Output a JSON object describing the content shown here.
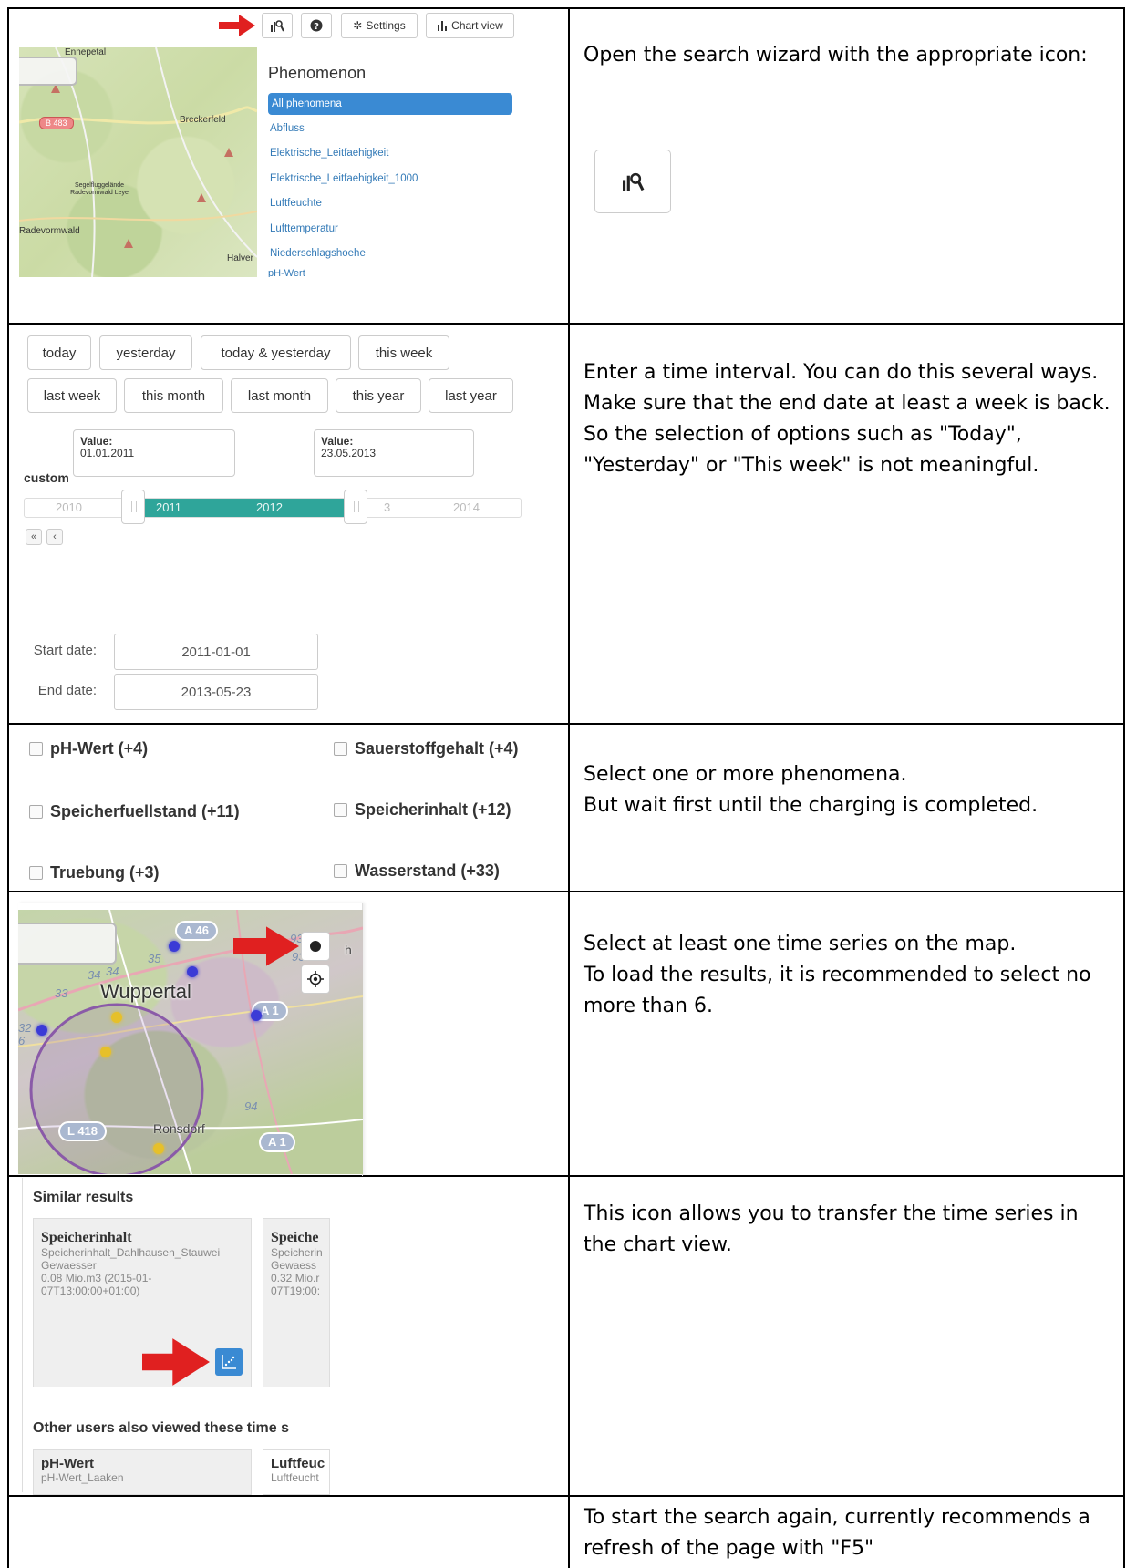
{
  "row1": {
    "toolbar": {
      "settings_label": "Settings",
      "chart_view_label": "Chart view"
    },
    "map_labels": {
      "ennepetal": "Ennepetal",
      "breckerfeld": "Breckerfeld",
      "radevormwald": "Radevormwald",
      "halver": "Halver",
      "road_badge": "B 483",
      "airfield": "Segelfluggelände Radevormwald Leye"
    },
    "phenomenon_title": "Phenomenon",
    "phenomena": [
      "All phenomena",
      "Abfluss",
      "Elektrische_Leitfaehigkeit",
      "Elektrische_Leitfaehigkeit_1000",
      "Luftfeuchte",
      "Lufttemperatur",
      "Niederschlagshoehe"
    ],
    "phenomena_cut": "pH-Wert",
    "instruction": "Open the search wizard with the appropriate icon:"
  },
  "row2": {
    "buttons_row1": [
      "today",
      "yesterday",
      "today & yesterday",
      "this week"
    ],
    "buttons_row2": [
      "last week",
      "this month",
      "last month",
      "this year",
      "last year"
    ],
    "tooltip_left": {
      "head": "Value:",
      "value": "01.01.2011"
    },
    "tooltip_right": {
      "head": "Value:",
      "value": "23.05.2013"
    },
    "custom_label": "custom",
    "slider_ticks": [
      "2010",
      "2011",
      "2012",
      "3",
      "2014"
    ],
    "nav_first": "«",
    "nav_prev": "‹",
    "start_label": "Start date:",
    "start_value": "2011-01-01",
    "end_label": "End date:",
    "end_value": "2013-05-23",
    "instruction": "Enter a time interval. You can do this several ways. Make sure that the end date at least a week is back. So the selection of options such as \"Today\", \"Yesterday\" or \"This week\" is not meaningful."
  },
  "row3": {
    "checkboxes": [
      "pH-Wert (+4)",
      "Sauerstoffgehalt (+4)",
      "Speicherfuellstand (+11)",
      "Speicherinhalt (+12)",
      "Truebung (+3)",
      "Wasserstand (+33)"
    ],
    "instruction_line1": "Select one or more phenomena.",
    "instruction_line2": "But wait first until the charging is completed."
  },
  "row4": {
    "city": "Wuppertal",
    "district": "Ronsdorf",
    "highways": [
      "A 46",
      "A 1",
      "L 418",
      "A 1"
    ],
    "route_numbers": [
      "35",
      "93",
      "93",
      "34",
      "34",
      "33",
      "32",
      "94",
      "6"
    ],
    "edge_letter": "h",
    "instruction_line1": "Select at least one time series on the map.",
    "instruction_line2": "To load the results, it is recommended to select no more than 6."
  },
  "row5": {
    "similar_title": "Similar results",
    "card1": {
      "title": "Speicherinhalt",
      "line1": "Speicherinhalt_Dahlhausen_Stauwei",
      "line2": "Gewaesser",
      "line3": "0.08 Mio.m3 (2015-01-",
      "line4": "07T13:00:00+01:00)"
    },
    "card2": {
      "title": "Speiche",
      "line1": "Speicherin",
      "line2": "Gewaess",
      "line3": "0.32 Mio.r",
      "line4": "07T19:00:"
    },
    "other_title": "Other users also viewed these time s",
    "card3": {
      "title": "pH-Wert",
      "line1": "pH-Wert_Laaken"
    },
    "card4": {
      "title": "Luftfeuc",
      "line1": "Luftfeucht"
    },
    "instruction": "This icon allows you to transfer the time series in the chart view."
  },
  "row6": {
    "instruction": "To start the search again, currently recommends a refresh of the page with \"F5\""
  },
  "colors": {
    "arrow_red": "#e02020",
    "link_blue": "#337ab7",
    "active_blue": "#3a8ad3",
    "slider_teal": "#2fa59a"
  }
}
